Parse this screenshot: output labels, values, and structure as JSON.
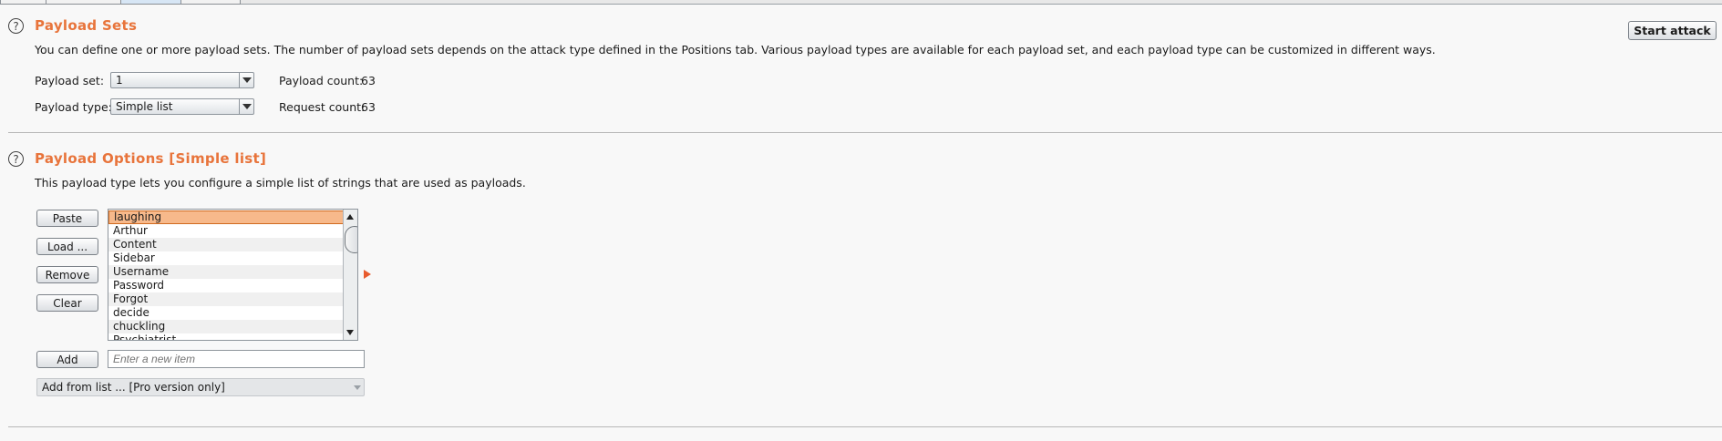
{
  "payload_sets": {
    "title": "Payload Sets",
    "description": "You can define one or more payload sets. The number of payload sets depends on the attack type defined in the Positions tab. Various payload types are available for each payload set, and each payload type can be customized in different ways.",
    "start_attack_label": "Start attack",
    "payload_set_label": "Payload set:",
    "payload_set_value": "1",
    "payload_type_label": "Payload type:",
    "payload_type_value": "Simple list",
    "payload_count_label": "Payload count:",
    "payload_count_value": "63",
    "request_count_label": "Request count:",
    "request_count_value": "63"
  },
  "payload_options": {
    "title": "Payload Options [Simple list]",
    "description": "This payload type lets you configure a simple list of strings that are used as payloads.",
    "buttons": {
      "paste": "Paste",
      "load": "Load ...",
      "remove": "Remove",
      "clear": "Clear",
      "add": "Add"
    },
    "items": [
      "laughing",
      "Arthur",
      "Content",
      "Sidebar",
      "Username",
      "Password",
      "Forgot",
      "decide",
      "chuckling",
      "Psychiatrist"
    ],
    "selected_index": 0,
    "new_item_placeholder": "Enter a new item",
    "add_from_list_label": "Add from list ... [Pro version only]"
  },
  "icons": {
    "help": "?"
  }
}
